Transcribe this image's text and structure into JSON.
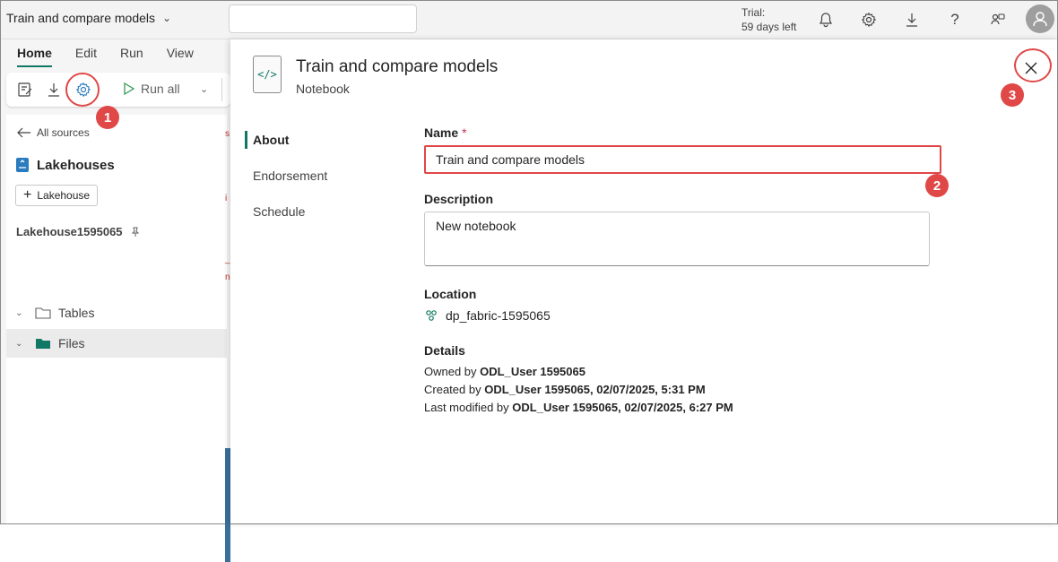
{
  "topbar": {
    "title": "Train and compare models",
    "trial_label": "Trial:",
    "trial_days": "59 days left"
  },
  "ribbon": {
    "tabs": [
      "Home",
      "Edit",
      "Run",
      "View"
    ],
    "run_all": "Run all"
  },
  "explorer": {
    "back_link": "All sources",
    "section_title": "Lakehouses",
    "add_button": "Lakehouse",
    "lakehouse_name": "Lakehouse1595065",
    "tree": [
      "Tables",
      "Files"
    ]
  },
  "panel": {
    "title": "Train and compare models",
    "subtitle": "Notebook",
    "nav": [
      "About",
      "Endorsement",
      "Schedule"
    ],
    "name_label": "Name",
    "required_mark": "*",
    "name_value": "Train and compare models",
    "description_label": "Description",
    "description_value": "New notebook",
    "location_label": "Location",
    "location_value": "dp_fabric-1595065",
    "details_label": "Details",
    "owned_by_label": "Owned by",
    "owned_by_value": "ODL_User 1595065",
    "created_by_label": "Created by",
    "created_by_value": "ODL_User 1595065, 02/07/2025, 5:31 PM",
    "modified_label": "Last modified by",
    "modified_value": "ODL_User 1595065, 02/07/2025, 6:27 PM"
  },
  "callouts": [
    "1",
    "2",
    "3"
  ],
  "colors": {
    "accent": "#117865",
    "callout": "#e04848"
  }
}
